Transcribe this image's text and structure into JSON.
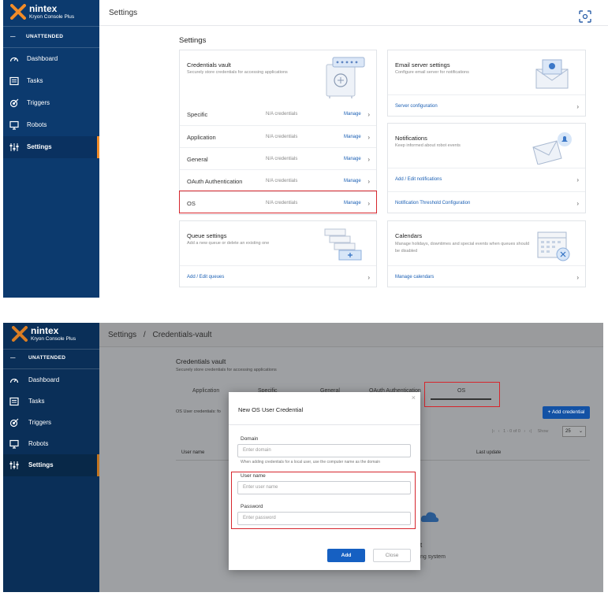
{
  "brand": {
    "name": "nintex",
    "product": "Kryon Console Plus"
  },
  "sidebar": {
    "mode": "UNATTENDED",
    "items": [
      {
        "label": "Dashboard",
        "icon": "dashboard-icon"
      },
      {
        "label": "Tasks",
        "icon": "tasks-icon"
      },
      {
        "label": "Triggers",
        "icon": "triggers-icon"
      },
      {
        "label": "Robots",
        "icon": "robots-icon"
      },
      {
        "label": "Settings",
        "icon": "settings-icon",
        "active": true
      }
    ]
  },
  "top": {
    "header_title": "Settings",
    "page_heading": "Settings",
    "vault": {
      "title": "Credentials vault",
      "subtitle": "Securely store credentials for accessing applications",
      "rows": [
        {
          "name": "Specific",
          "count": "N/A credentials",
          "action": "Manage"
        },
        {
          "name": "Application",
          "count": "N/A credentials",
          "action": "Manage"
        },
        {
          "name": "General",
          "count": "N/A credentials",
          "action": "Manage"
        },
        {
          "name": "OAuth Authentication",
          "count": "N/A credentials",
          "action": "Manage"
        },
        {
          "name": "OS",
          "count": "N/A credentials",
          "action": "Manage"
        }
      ]
    },
    "queue": {
      "title": "Queue settings",
      "subtitle": "Add a new queue or delete an existing one",
      "link": "Add / Edit queues"
    },
    "email": {
      "title": "Email server settings",
      "subtitle": "Configure email server for notifications",
      "link": "Server configuration"
    },
    "notifications": {
      "title": "Notifications",
      "subtitle": "Keep informed about robot events",
      "links": [
        "Add / Edit notifications",
        "Notification Threshold Configuration"
      ]
    },
    "calendars": {
      "title": "Calendars",
      "subtitle": "Manage holidays, downtimes and special events when queues should be disabled",
      "link": "Manage calendars"
    }
  },
  "bottom": {
    "breadcrumb": {
      "root": "Settings",
      "sep": "/",
      "current": "Credentials-vault"
    },
    "vault_title": "Credentials vault",
    "vault_subtitle": "Securely store credentials for accessing applications",
    "tabs": [
      "Application",
      "Specific",
      "General",
      "OAuth Authentication",
      "OS"
    ],
    "os_note": "OS User credentials: fo",
    "add_button": "+ Add credential",
    "pager": "1 - 0 of 0",
    "show_label": "Show",
    "page_size": "25",
    "col_user": "User name",
    "col_update": "Last update",
    "empty_line1": "t",
    "empty_line2": "ng system",
    "modal": {
      "title": "New OS User Credential",
      "domain_label": "Domain",
      "domain_placeholder": "Enter domain",
      "domain_hint": "When adding credentials for a local user, use the computer name as the domain",
      "username_label": "User name",
      "username_placeholder": "Enter user name",
      "password_label": "Password",
      "password_placeholder": "Enter password",
      "add": "Add",
      "close": "Close"
    }
  },
  "colors": {
    "sidebar": "#0c3a6e",
    "accent": "#f28c28",
    "link": "#1a5fb4",
    "highlight": "#d6262d",
    "primary_button": "#1660c2"
  }
}
